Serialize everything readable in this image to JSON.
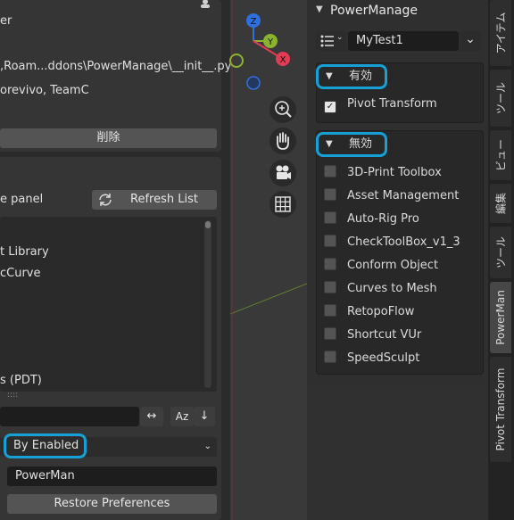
{
  "left": {
    "author_label": "er",
    "file_path": ",Roam...ddons\\PowerManage\\__init__.py",
    "authors": "orevivo, TeamC",
    "remove_button": "削除",
    "panel_label": "e panel",
    "refresh_button": "Refresh List",
    "list_items": [
      "t Library",
      "cCurve",
      "s (PDT)"
    ],
    "sort_button": "Aᴢ",
    "sort_dropdown": "By Enabled",
    "name_field": "PowerMan",
    "restore_button": "Restore Preferences"
  },
  "viewport": {
    "axes": [
      "Z",
      "Y",
      "X"
    ],
    "axis_colors": {
      "z": "#2e70e0",
      "y": "#8ab32f",
      "x": "#e13c53"
    }
  },
  "npanel": {
    "title": "PowerManage",
    "preset_value": "MyTest1",
    "enabled_header": "有効",
    "enabled_items": [
      "Pivot Transform"
    ],
    "disabled_header": "無効",
    "disabled_items": [
      "3D-Print Toolbox",
      "Asset Management",
      "Auto-Rig Pro",
      "CheckToolBox_v1_3",
      "Conform Object",
      "Curves to Mesh",
      "RetopoFlow",
      "Shortcut VUr",
      "SpeedSculpt"
    ]
  },
  "tabs": [
    "アイテム",
    "ツール",
    "ビュー",
    "編集",
    "ツール",
    "PowerMan",
    "Pivot Transform"
  ],
  "colors": {
    "highlight": "#16a0d6",
    "panel": "#2f2f2f",
    "button": "#545454"
  }
}
